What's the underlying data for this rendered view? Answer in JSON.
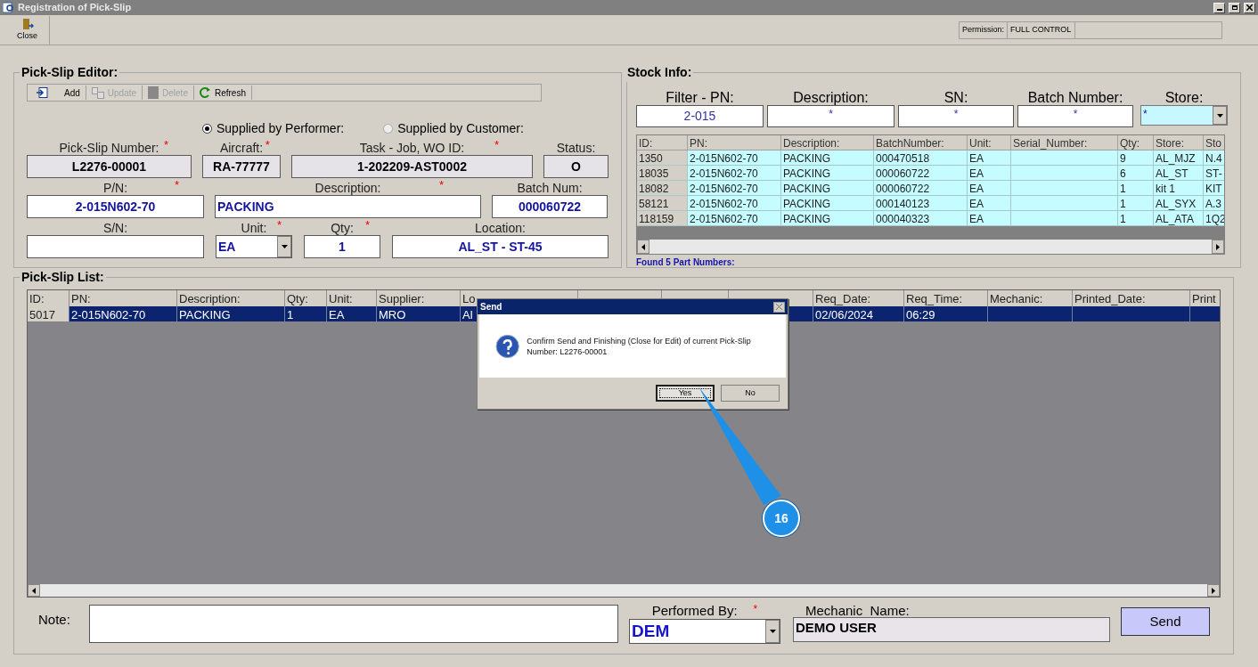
{
  "window": {
    "title": "Registration of Pick-Slip"
  },
  "toolbar": {
    "close_label": "Close",
    "permission_label": "Permission:",
    "permission_value": "FULL CONTROL"
  },
  "editor": {
    "title": "Pick-Slip Editor:",
    "actions": [
      {
        "label": "Add",
        "disabled": false
      },
      {
        "label": "Update",
        "disabled": true
      },
      {
        "label": "Delete",
        "disabled": true
      },
      {
        "label": "Refresh",
        "disabled": false
      }
    ],
    "supplied_by": [
      {
        "label": "Supplied by Performer:",
        "selected": true
      },
      {
        "label": "Supplied by Customer:",
        "selected": false
      }
    ],
    "rows": [
      [
        {
          "label": "Pick-Slip Number:",
          "value": "L2276-00001",
          "required": true,
          "kind": "readonly"
        },
        {
          "label": "Aircraft:",
          "value": "RA-77777",
          "required": true,
          "kind": "readonly"
        },
        {
          "label": "Task - Job, WO ID:",
          "value": "1-202209-AST0002",
          "required": true,
          "kind": "readonly"
        },
        {
          "label": "Status:",
          "value": "O",
          "required": false,
          "kind": "readonly"
        }
      ],
      [
        {
          "label": "P/N:",
          "value": "2-015N602-70",
          "required": true,
          "kind": "input"
        },
        {
          "label": "Description:",
          "value": "PACKING",
          "required": true,
          "kind": "text"
        },
        {
          "label": "Batch Num:",
          "value": "000060722",
          "required": false,
          "kind": "input"
        }
      ],
      [
        {
          "label": "S/N:",
          "required": false,
          "kind": "input"
        },
        {
          "label": "Unit:",
          "value": "EA",
          "required": true,
          "kind": "dropdown"
        },
        {
          "label": "Qty:",
          "value": "1",
          "required": true,
          "kind": "input"
        },
        {
          "label": "Location:",
          "value": "AL_ST - ST-45",
          "required": false,
          "kind": "input"
        }
      ]
    ]
  },
  "stock": {
    "title": "Stock Info:",
    "filters": [
      {
        "label": "Filter - PN:",
        "value": "2-015",
        "kind": "input"
      },
      {
        "label": "Description:",
        "value": "*",
        "kind": "input"
      },
      {
        "label": "SN:",
        "value": "*",
        "kind": "input"
      },
      {
        "label": "Batch Number:",
        "value": "*",
        "kind": "input"
      },
      {
        "label": "Store:",
        "value": "*",
        "kind": "dropdown"
      }
    ],
    "columns": [
      "ID:",
      "PN:",
      "Description:",
      "BatchNumber:",
      "Unit:",
      "Serial_Number:",
      "Qty:",
      "Store:",
      "Sto"
    ],
    "rows": [
      {
        "cells": [
          "1350",
          "2-015N602-70",
          "PACKING",
          "000470518",
          "EA",
          null,
          "9",
          "AL_MJZ",
          "N.4"
        ]
      },
      {
        "cells": [
          "18035",
          "2-015N602-70",
          "PACKING",
          "000060722",
          "EA",
          null,
          "6",
          "AL_ST",
          "ST-"
        ]
      },
      {
        "cells": [
          "18082",
          "2-015N602-70",
          "PACKING",
          "000060722",
          "EA",
          null,
          "1",
          "kit 1",
          "KIT"
        ]
      },
      {
        "cells": [
          "58121",
          "2-015N602-70",
          "PACKING",
          "000140123",
          "EA",
          null,
          "1",
          "AL_SYX",
          "A.3"
        ]
      },
      {
        "cells": [
          "118159",
          "2-015N602-70",
          "PACKING",
          "000040323",
          "EA",
          null,
          "1",
          "AL_ATA",
          "1Q2"
        ]
      }
    ],
    "found": "Found 5 Part Numbers:"
  },
  "list": {
    "title": "Pick-Slip List:",
    "columns": [
      "ID:",
      "PN:",
      "Description:",
      "Qty:",
      "Unit:",
      "Supplier:",
      "Lo",
      null,
      null,
      null,
      "Req_Date:",
      "Req_Time:",
      "Mechanic:",
      "Printed_Date:",
      "Print"
    ],
    "rows": [
      {
        "selected": true,
        "cells": [
          "5017",
          "2-015N602-70",
          "PACKING",
          "1",
          "EA",
          "MRO",
          "Al",
          null,
          null,
          null,
          "02/06/2024",
          "06:29",
          null,
          null,
          null
        ]
      }
    ]
  },
  "footer": {
    "note_label": "Note:",
    "performed_by_label": "Performed By:",
    "performed_by_required": true,
    "performed_by_value": "DEM",
    "mechanic_label": "Mechanic  Name:",
    "mechanic_value": "DEMO USER",
    "send_label": "Send"
  },
  "dialog": {
    "title": "Send",
    "message": "Confirm Send and Finishing (Close for Edit) of current Pick-Slip Number: L2276-00001",
    "buttons": [
      {
        "label": "Yes",
        "selected": true
      },
      {
        "label": "No",
        "selected": false
      }
    ]
  },
  "callout": {
    "label": "16"
  }
}
